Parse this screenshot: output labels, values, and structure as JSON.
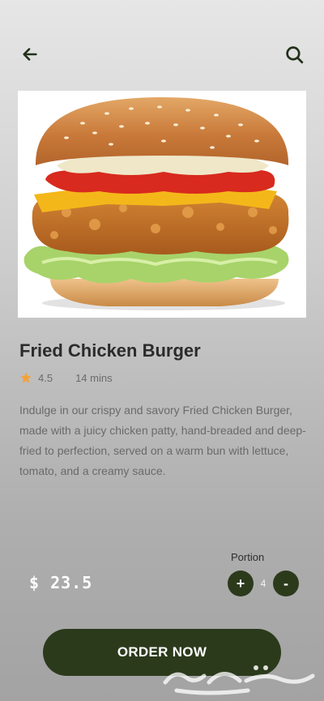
{
  "header": {
    "back_icon": "arrow-left-icon",
    "search_icon": "search-icon"
  },
  "product": {
    "name": "Fried Chicken Burger",
    "rating": "4.5",
    "time": "14 mins",
    "description": "Indulge in our crispy and savory Fried Chicken Burger, made with a juicy chicken patty, hand-breaded and deep-fried to perfection, served on a warm bun with lettuce, tomato, and a creamy sauce.",
    "price": "$ 23.5"
  },
  "portion": {
    "label": "Portion",
    "plus": "+",
    "minus": "-",
    "quantity": "4"
  },
  "order": {
    "label": "ORDER NOW"
  },
  "colors": {
    "accent": "#2c3a1c",
    "star": "#f2a33a"
  }
}
